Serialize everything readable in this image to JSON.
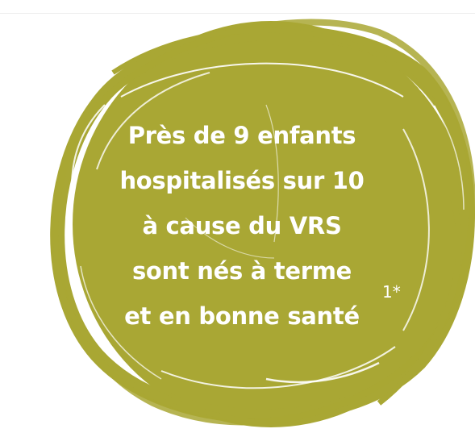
{
  "graphic": {
    "lines": [
      "Près de 9 enfants",
      "hospitalisés sur 10",
      "à cause du VRS",
      "sont nés à terme",
      "et en bonne santé"
    ],
    "footnote_marker": "1*",
    "colors": {
      "circle": "#a9a734",
      "text": "#ffffff",
      "background": "#ffffff"
    }
  }
}
